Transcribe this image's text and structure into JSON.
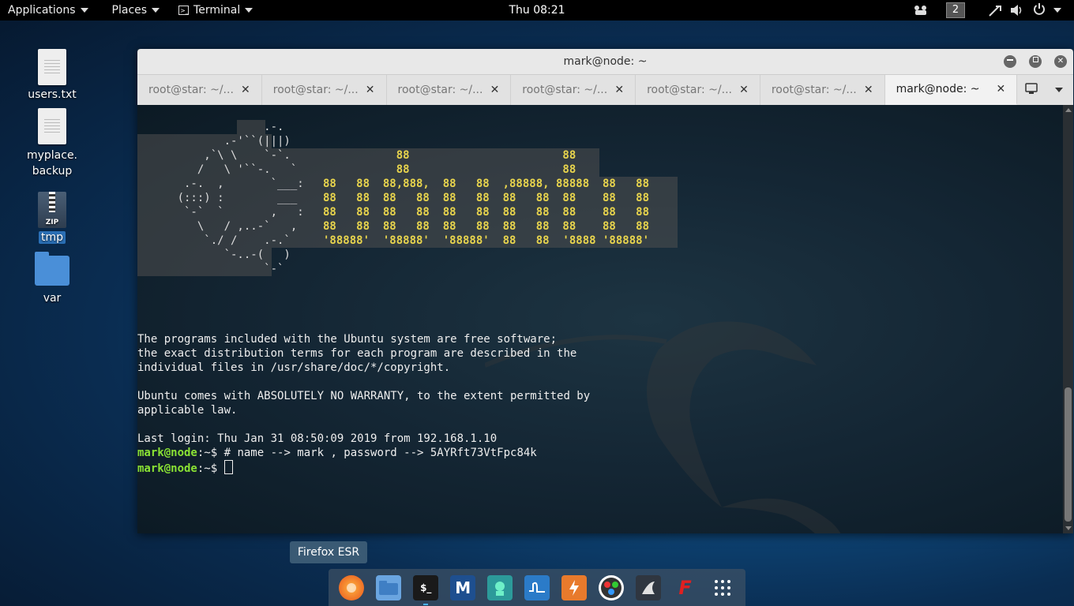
{
  "topbar": {
    "applications": "Applications",
    "places": "Places",
    "terminal": "Terminal",
    "clock": "Thu 08:21",
    "workspace": "2"
  },
  "desktop": {
    "icons": [
      {
        "label": "users.txt"
      },
      {
        "label": "myplace.\nbackup"
      },
      {
        "label": "tmp"
      },
      {
        "label": "var"
      }
    ]
  },
  "window": {
    "title": "mark@node: ~",
    "tabs": [
      {
        "label": "root@star: ~/..."
      },
      {
        "label": "root@star: ~/..."
      },
      {
        "label": "root@star: ~/..."
      },
      {
        "label": "root@star: ~/..."
      },
      {
        "label": "root@star: ~/..."
      },
      {
        "label": "root@star: ~/..."
      },
      {
        "label": "mark@node: ~"
      }
    ]
  },
  "terminal": {
    "logo_art": "                   .-.\n             .-'``(|||)\n          ,`\\ \\    `-`.\n         /   \\ '``-.   `\n       .-.  ,       `___:\n      (:::) :        ___\n       `-`  `       ,   :\n         \\   / ,..-`   ,\n          `./ /    .-.`\n             `-..-(   )\n                   `-`",
    "big_art": "           88                       88\n           88                       88\n88   88  88,888,  88   88  ,88888, 88888  88   88\n88   88  88   88  88   88  88   88  88    88   88\n88   88  88   88  88   88  88   88  88    88   88\n88   88  88   88  88   88  88   88  88    88   88\n'88888'  '88888'  '88888'  88   88  '8888 '88888'",
    "motd1": "The programs included with the Ubuntu system are free software;",
    "motd2": "the exact distribution terms for each program are described in the",
    "motd3": "individual files in /usr/share/doc/*/copyright.",
    "motd4": "Ubuntu comes with ABSOLUTELY NO WARRANTY, to the extent permitted by",
    "motd5": "applicable law.",
    "last_login": "Last login: Thu Jan 31 08:50:09 2019 from 192.168.1.10",
    "prompt_user": "mark@node",
    "prompt_path": ":~$",
    "command1": " # name --> mark , password --> 5AYRft73VtFpc84k",
    "command2": " "
  },
  "tooltip": "Firefox ESR",
  "dock": {
    "items": [
      {
        "icon": "firefox-icon",
        "color": "#f07a1c"
      },
      {
        "icon": "files-icon",
        "color": "#5a9ad8"
      },
      {
        "icon": "terminal-icon",
        "color": "#222"
      },
      {
        "icon": "metasploit-icon",
        "color": "#1d4f8c"
      },
      {
        "icon": "armitage-icon",
        "color": "#2c8a8a"
      },
      {
        "icon": "wireshark-icon",
        "color": "#2a77c2"
      },
      {
        "icon": "burpsuite-icon",
        "color": "#e8702a"
      },
      {
        "icon": "maltego-icon",
        "color": "#444"
      },
      {
        "icon": "kali-tools-icon",
        "color": "#333"
      },
      {
        "icon": "faraday-icon",
        "color": "#d8261e"
      },
      {
        "icon": "show-apps-icon",
        "color": "#fff"
      }
    ]
  }
}
